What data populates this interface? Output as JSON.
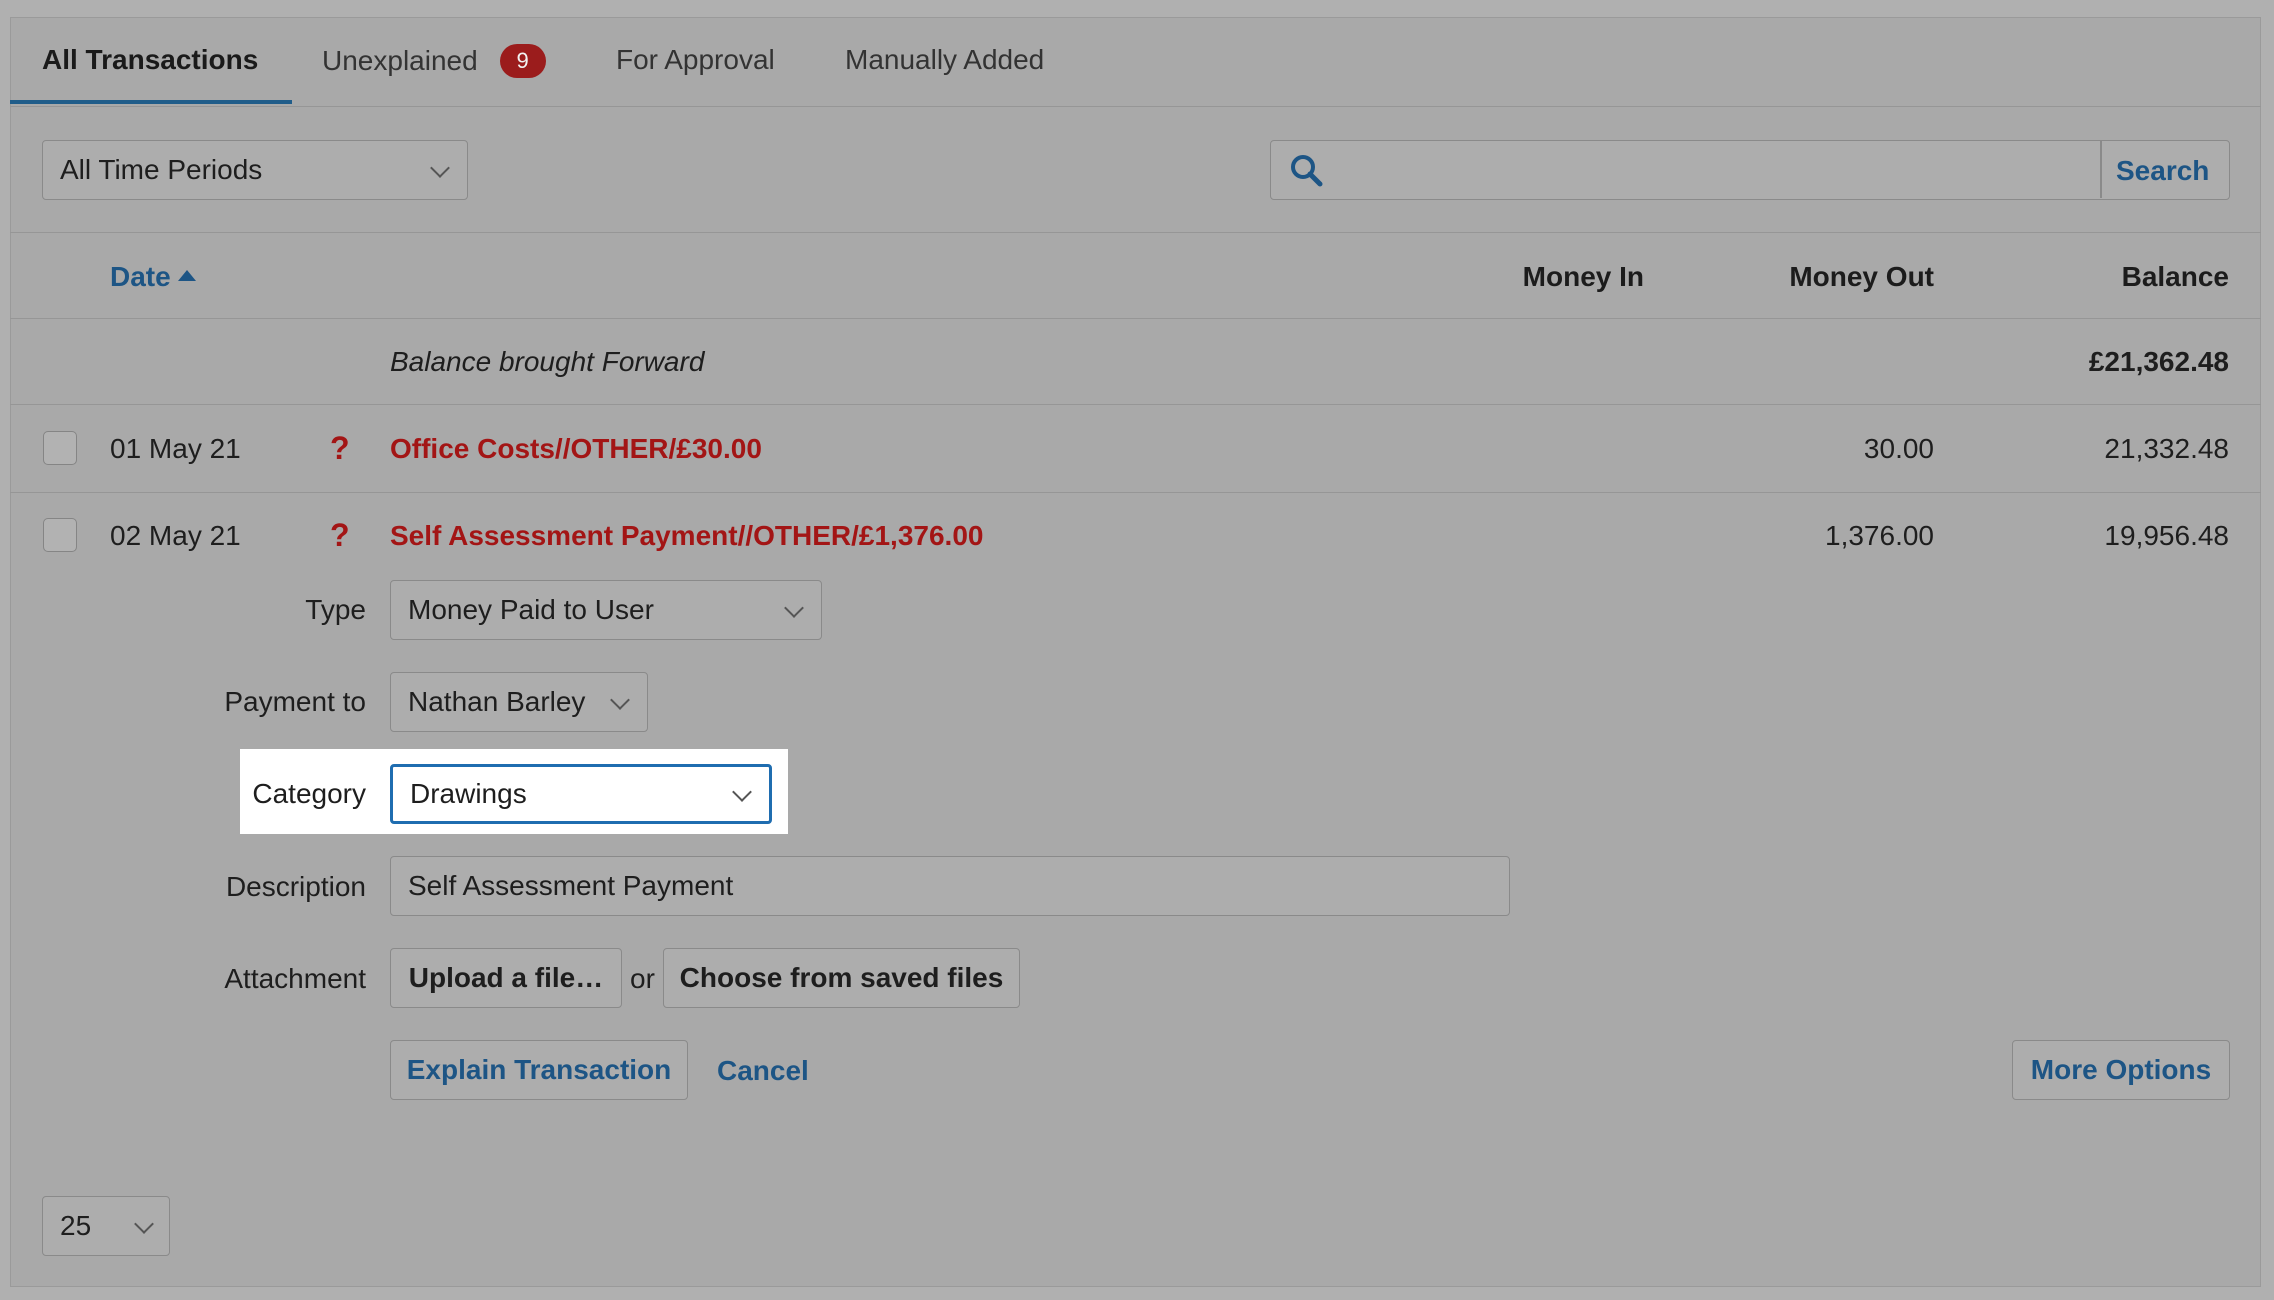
{
  "tabs": [
    {
      "label": "All Transactions"
    },
    {
      "label": "Unexplained",
      "badge": "9"
    },
    {
      "label": "For Approval"
    },
    {
      "label": "Manually Added"
    }
  ],
  "filters": {
    "period": "All Time Periods",
    "search_placeholder": "",
    "search_button": "Search"
  },
  "table": {
    "headers": {
      "date": "Date",
      "money_in": "Money In",
      "money_out": "Money Out",
      "balance": "Balance"
    },
    "brought_forward": {
      "label": "Balance brought Forward",
      "balance": "£21,362.48"
    },
    "rows": [
      {
        "date": "01 May 21",
        "description": "Office Costs//OTHER/£30.00",
        "money_in": "",
        "money_out": "30.00",
        "balance": "21,332.48"
      },
      {
        "date": "02 May 21",
        "description": "Self Assessment Payment//OTHER/£1,376.00",
        "money_in": "",
        "money_out": "1,376.00",
        "balance": "19,956.48"
      }
    ]
  },
  "form": {
    "type_label": "Type",
    "type_value": "Money Paid to User",
    "payment_to_label": "Payment to",
    "payment_to_value": "Nathan Barley",
    "category_label": "Category",
    "category_value": "Drawings",
    "description_label": "Description",
    "description_value": "Self Assessment Payment",
    "attachment_label": "Attachment",
    "upload_button": "Upload a file…",
    "or_text": "or",
    "choose_button": "Choose from saved files",
    "explain_button": "Explain Transaction",
    "cancel_link": "Cancel",
    "more_options_button": "More Options"
  },
  "pagination": {
    "per_page": "25"
  },
  "colors": {
    "accent": "#1d5585",
    "unexplained_red": "#a31515",
    "badge_red": "#9b1c1c",
    "focus_blue": "#1f6db0"
  }
}
